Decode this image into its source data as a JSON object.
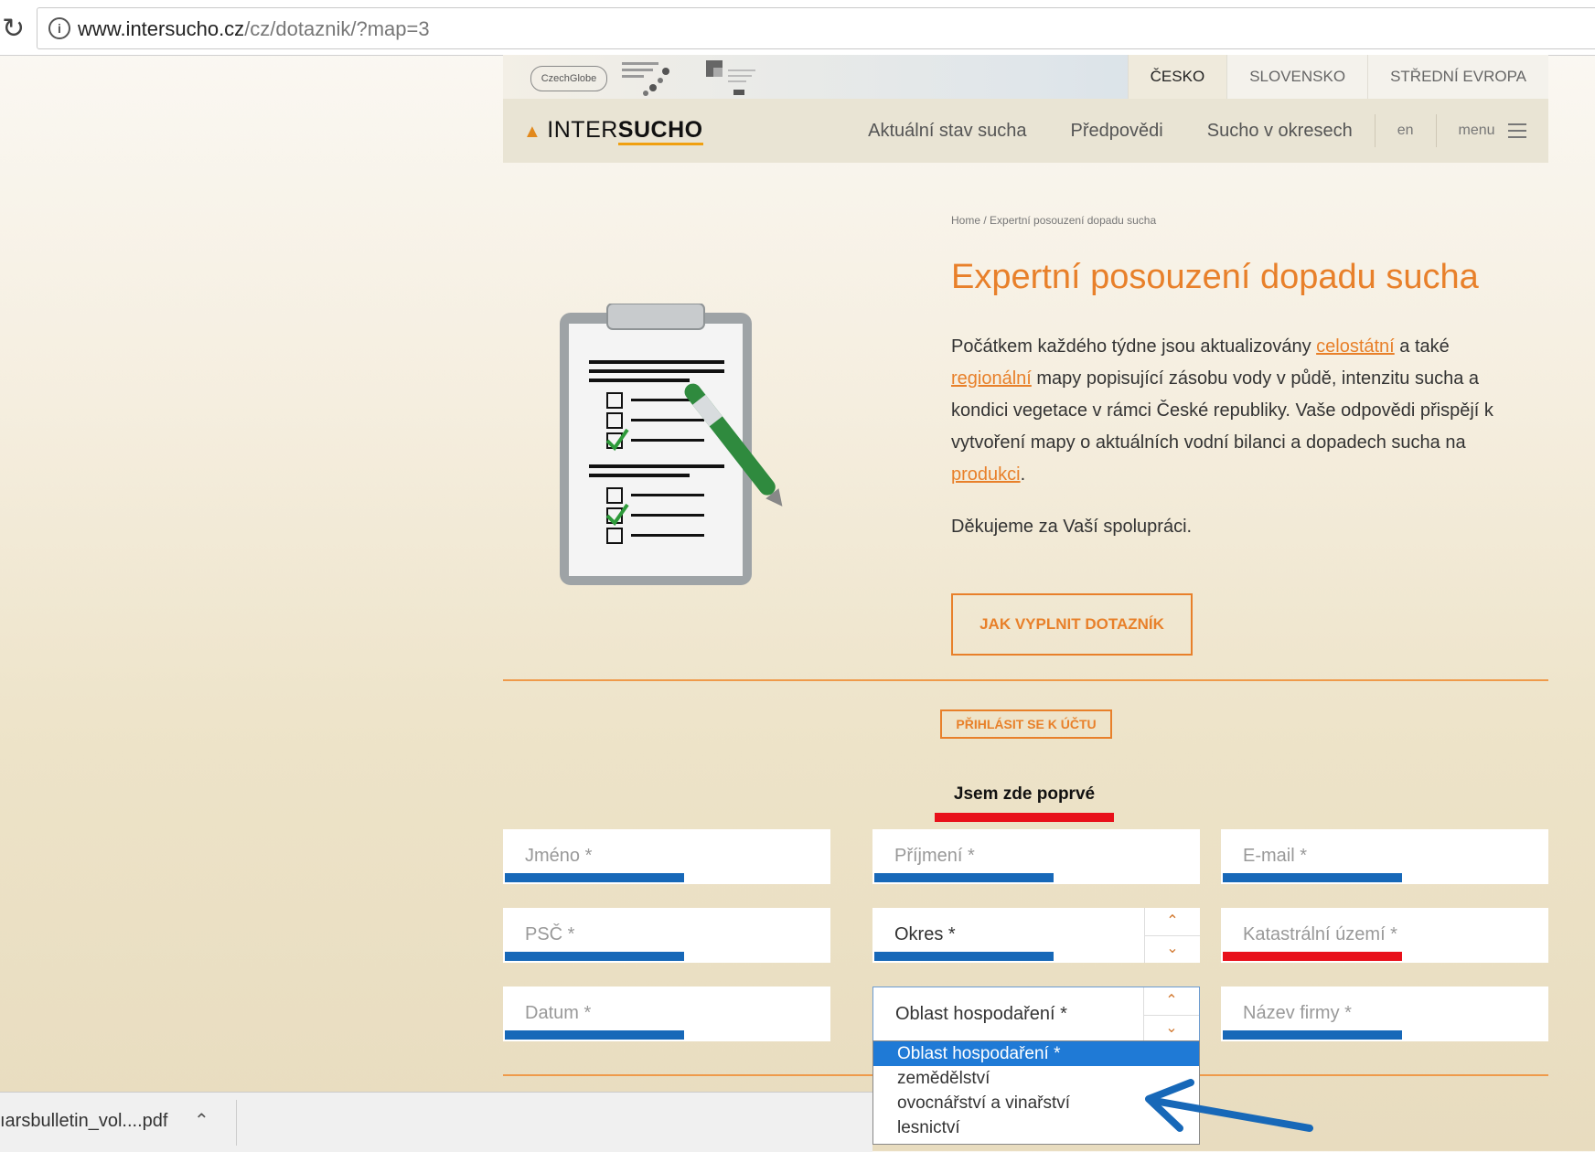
{
  "browser": {
    "url_host": "www.intersucho.cz",
    "url_path": "/cz/dotaznik/?map=3"
  },
  "header": {
    "logo_text": "CzechGlobe",
    "region_tabs": [
      "ČESKO",
      "SLOVENSKO",
      "STŘEDNÍ EVROPA"
    ],
    "brand_prefix": "INTER",
    "brand_bold": "SUCHO",
    "nav": [
      "Aktuální stav sucha",
      "Předpovědi",
      "Sucho v okresech"
    ],
    "lang": "en",
    "menu": "menu"
  },
  "content": {
    "breadcrumb": "Home / Expertní posouzení dopadu sucha",
    "title": "Expertní posouzení dopadu sucha",
    "intro_1": "Počátkem každého týdne jsou aktualizovány ",
    "link_1": "celostátní",
    "intro_2": " a také ",
    "link_2": "regionální",
    "intro_3": " mapy popisující zásobu vody v půdě, intenzitu sucha a kondici vegetace v rámci České republiky. Vaše odpovědi přispějí k vytvoření mapy o aktuálních vodní bilanci a dopadech sucha na ",
    "link_3": "produkci",
    "intro_4": ".",
    "thanks": "Děkujeme za Vaší spolupráci.",
    "howto_button": "JAK VYPLNIT DOTAZNÍK",
    "login_button": "PŘIHLÁSIT SE K ÚČTU",
    "first_time": "Jsem zde poprvé"
  },
  "form": {
    "jmeno": "Jméno *",
    "prijmeni": "Příjmení *",
    "email": "E-mail *",
    "psc": "PSČ *",
    "okres": "Okres *",
    "katastr": "Katastrální území *",
    "datum": "Datum *",
    "oblast": "Oblast hospodaření *",
    "firma": "Název firmy *"
  },
  "dropdown": {
    "options": [
      "Oblast hospodaření *",
      "zemědělství",
      "ovocnářství a vinařství",
      "lesnictví"
    ],
    "selected_index": 0
  },
  "download": {
    "file": "ıarsbulletin_vol....pdf"
  },
  "colors": {
    "accent": "#e8802a",
    "underline_blue": "#1768b8",
    "underline_red": "#e8101a",
    "selected_blue": "#1f7ad6"
  }
}
